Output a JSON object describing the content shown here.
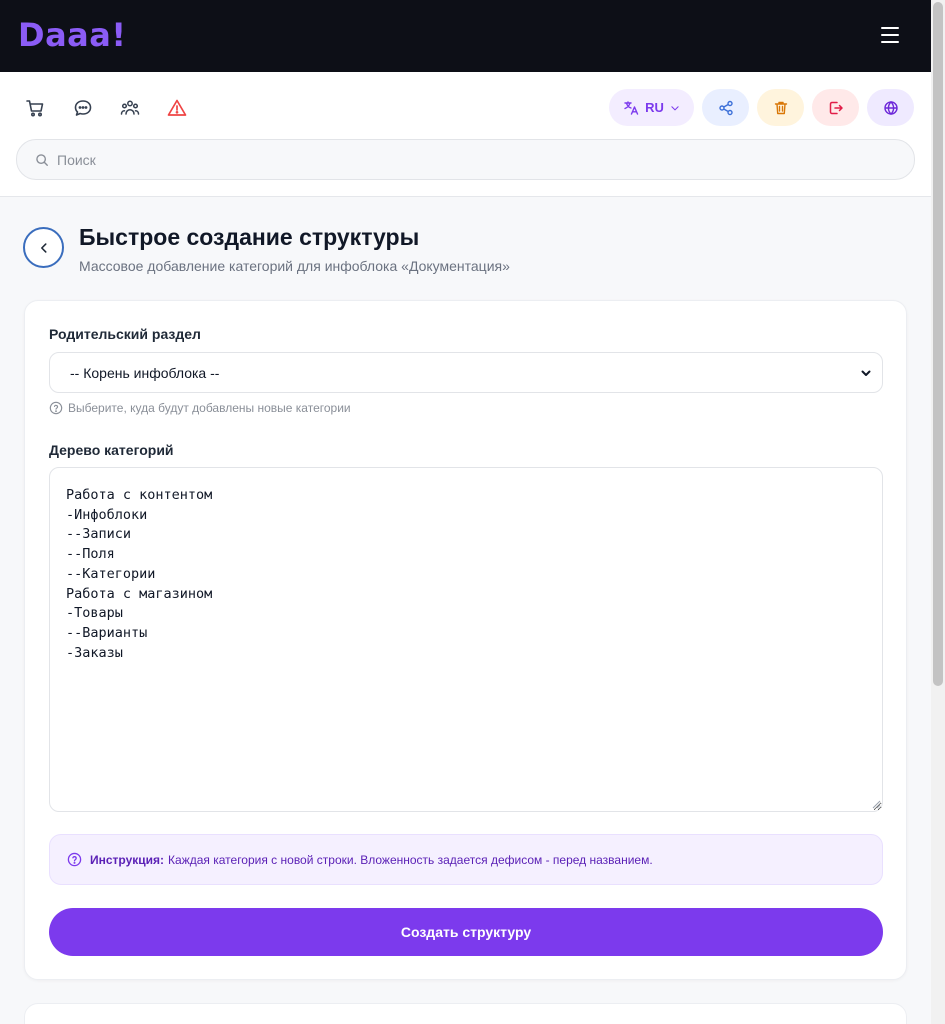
{
  "header": {
    "logo": "Daaa!"
  },
  "toolbar": {
    "icons": [
      "cart-icon",
      "chat-icon",
      "users-icon",
      "alert-icon"
    ],
    "language": "RU",
    "colors": {
      "alert": "#ef4444",
      "accent": "#7c3aed",
      "share": "#3b6fd8",
      "trash": "#d97706",
      "logout": "#e11d48",
      "globe": "#6d28d9"
    }
  },
  "search": {
    "placeholder": "Поиск"
  },
  "page": {
    "title": "Быстрое создание структуры",
    "subtitle": "Массовое добавление категорий для инфоблока «Документация»"
  },
  "form": {
    "parent_label": "Родительский раздел",
    "parent_value": "-- Корень инфоблока --",
    "parent_hint": "Выберите, куда будут добавлены новые категории",
    "tree_label": "Дерево категорий",
    "tree_value": "Работа с контентом\n-Инфоблоки\n--Записи\n--Поля\n--Категории\nРабота с магазином\n-Товары\n--Варианты\n-Заказы",
    "instruction_label": "Инструкция:",
    "instruction_text": "Каждая категория с новой строки. Вложенность задается дефисом - перед названием.",
    "submit_label": "Создать структуру"
  }
}
